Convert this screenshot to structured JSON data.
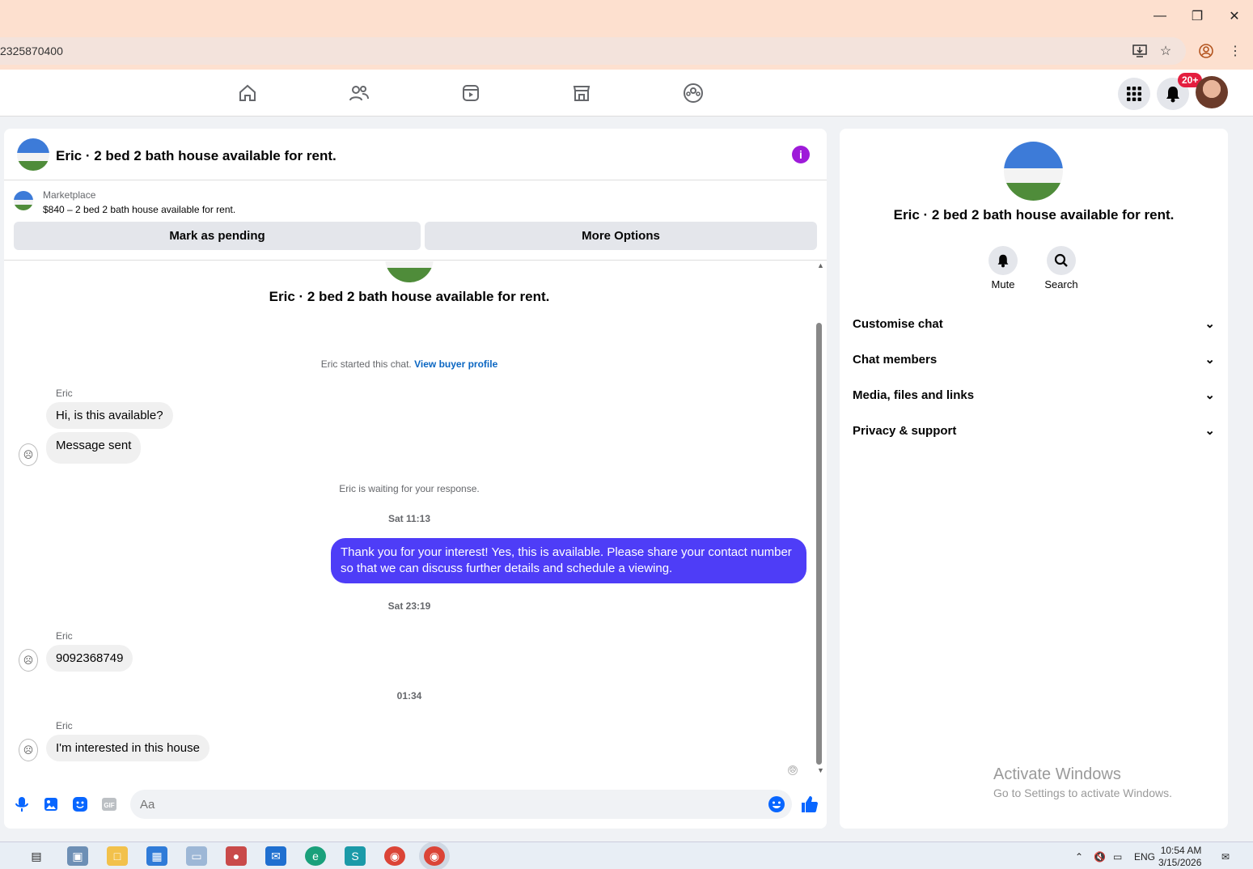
{
  "browser": {
    "url": "2325870400",
    "minimize_icon": "minimize-icon",
    "restore_icon": "restore-icon",
    "close_icon": "close-icon"
  },
  "nav": {
    "tabs": [
      "home-icon",
      "friends-icon",
      "video-icon",
      "marketplace-icon",
      "groups-icon"
    ],
    "notification_count": "20+"
  },
  "chat": {
    "title": "Eric · 2 bed 2 bath house available for rent.",
    "marketplace_label": "Marketplace",
    "listing_text": "$840 – 2 bed 2 bath house available for rent.",
    "mark_pending_label": "Mark as pending",
    "more_options_label": "More Options",
    "thread_title": "Eric · 2 bed 2 bath house available for rent.",
    "started_text": "Eric started this chat.",
    "view_profile_link": "View buyer profile",
    "sender_name_1": "Eric",
    "msg_1": "Hi, is this available?",
    "msg_2": "Message sent",
    "waiting_text": "Eric is waiting for your response.",
    "time_1": "Sat 11:13",
    "msg_out": "Thank you for your interest! Yes, this is available. Please share your contact number so that we can discuss further details and schedule a viewing.",
    "time_2": "Sat 23:19",
    "sender_name_2": "Eric",
    "msg_3": "9092368749",
    "time_3": "01:34",
    "sender_name_3": "Eric",
    "msg_4": "I'm interested in this house",
    "input_placeholder": "Aa"
  },
  "side": {
    "title": "Eric · 2 bed 2 bath house available for rent.",
    "mute_label": "Mute",
    "search_label": "Search",
    "rows": [
      "Customise chat",
      "Chat members",
      "Media, files and links",
      "Privacy & support"
    ],
    "watermark_title": "Activate Windows",
    "watermark_sub": "Go to Settings to activate Windows."
  },
  "taskbar": {
    "lang": "ENG",
    "time": "10:54 AM",
    "date": "3/15/2026"
  },
  "colors": {
    "brand_blue": "#0866ff",
    "outgoing_bubble": "#4e3df7",
    "info_purple": "#9e1bd9",
    "badge_red": "#e41e3f"
  }
}
